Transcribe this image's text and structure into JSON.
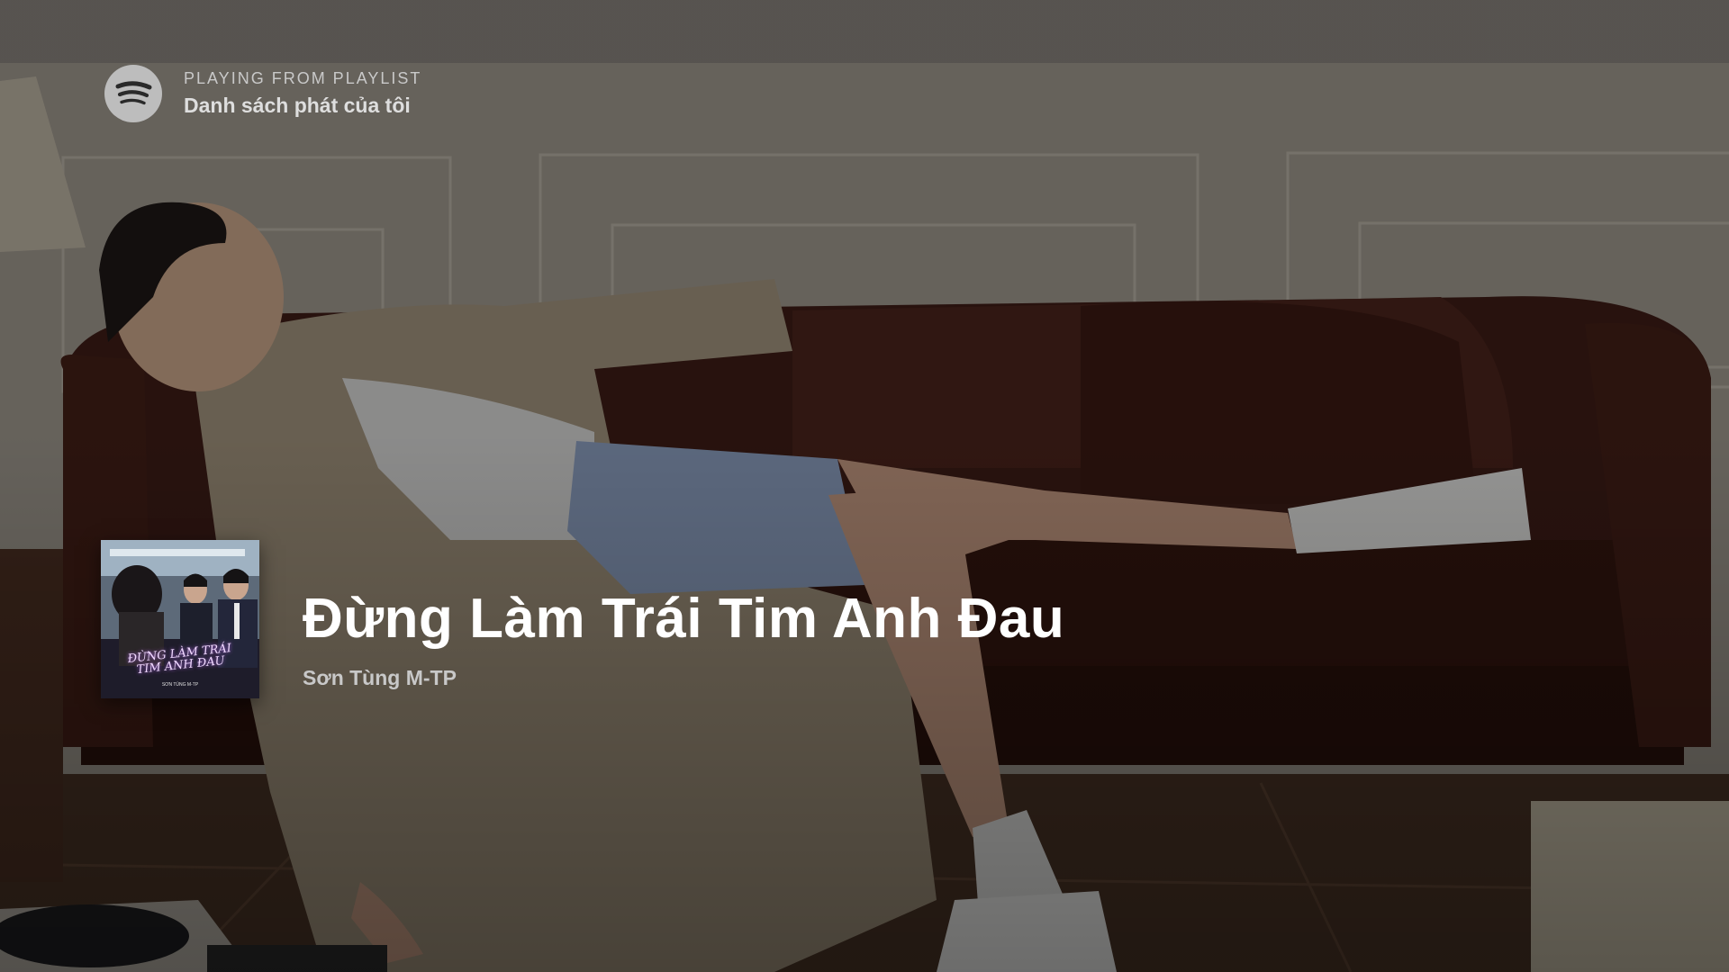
{
  "context": {
    "label": "PLAYING FROM PLAYLIST",
    "name": "Danh sách phát của tôi",
    "logo_icon": "spotify-logo-icon"
  },
  "track": {
    "title": "Đừng Làm Trái Tim Anh Đau",
    "artist": "Sơn Tùng M-TP"
  },
  "cover": {
    "title_line1": "ĐỪNG LÀM TRÁI",
    "title_line2": "TIM ANH ĐAU",
    "artist": "SƠN TÙNG M-TP"
  },
  "colors": {
    "title": "#ffffff",
    "subtitle": "#c8c8c8",
    "logo": "#bdbdbd"
  }
}
